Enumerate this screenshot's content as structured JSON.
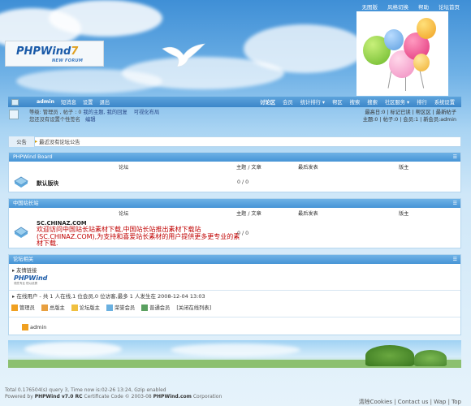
{
  "top_links": [
    "无图版",
    "风格切换",
    "帮助",
    "论坛首页"
  ],
  "logo": {
    "main": "PHPWind",
    "version": "7",
    "sub": "NEW FORUM"
  },
  "nav": {
    "username": "admin",
    "user_links": [
      "短消息",
      "设置",
      "退出"
    ],
    "menu": [
      "讨论区",
      "会员",
      "统计排行 ▾",
      "帮区",
      "搜索",
      "搜索",
      "社区服务 ▾",
      "排行",
      "系统设置"
    ]
  },
  "user_panel": {
    "line1": "等级: 管理员 , 帖子 : 0",
    "line1_links": "我的主题, 我的回复",
    "mode": "可视化布局",
    "line2": "您还没有设置个性签名",
    "edit": "编辑",
    "right1": "最高日:0 | 标记已读 | 帮区区 | 最新帖子",
    "right2": "主题:0 | 帖子:0 | 会员:1 | 新会员:admin"
  },
  "notice": {
    "tab": "公告",
    "text": "最近没有论坛公告"
  },
  "category1": {
    "title": "PHPWind Board",
    "col_forum": "论坛",
    "col_topics": "主题 / 文章",
    "col_last": "最后发表",
    "col_mod": "版主",
    "forum_name": "默认版块",
    "counts": "0 / 0"
  },
  "category2": {
    "title": "中国站长站",
    "col_forum": "论坛",
    "col_topics": "主题 / 文章",
    "col_last": "最后发表",
    "col_mod": "版主",
    "forum_name": "SC.CHINAZ.COM",
    "forum_desc": "欢迎访问中国站长站素材下载,中国站长站推出素材下载站(SC.CHINAZ.COM),为支持和喜爱站长素材的用户提供更多更专业的素材下载.",
    "counts": "0 / 0"
  },
  "category3": {
    "title": "论坛相关",
    "friend_links": "友情链接",
    "logo_text": "PHPWind",
    "logo_tag": "领先专业 恒以优秀",
    "online_label": "在线用户",
    "online_text": "- 共 1 人在线,1 位会员,0 位访客,最多 1 人发生在 2008-12-04 13:03",
    "legend": [
      "管理员",
      "总版主",
      "论坛版主",
      "荣誉会员",
      "普通会员"
    ],
    "legend_link": "[关闭在线列表]",
    "online_user": "admin"
  },
  "footer": {
    "line1": "Total 0.176504(s) query 3, Time now is:02-26 13:24, Gzip enabled",
    "line2_a": "Powered by ",
    "line2_b": "PHPWind v7.0 RC",
    "line2_c": " Certificate Code © 2003-08 ",
    "line2_d": "PHPWind.com",
    "line2_e": " Corporation",
    "links": "清除Cookies | Contact us | Wap | Top"
  },
  "colors": {
    "accent": "#3b86c9",
    "desc_red": "#c00000",
    "header_blue": "#4694d6"
  }
}
